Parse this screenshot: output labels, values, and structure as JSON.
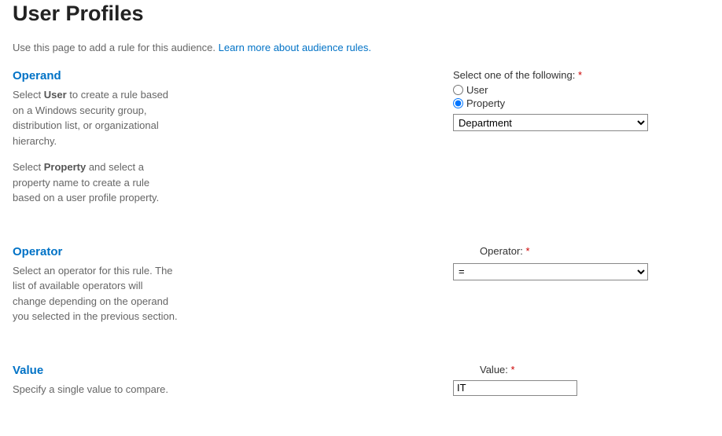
{
  "page_title": "User Profiles",
  "intro": {
    "text": "Use this page to add a rule for this audience. ",
    "link": "Learn more about audience rules."
  },
  "sections": {
    "operand": {
      "heading": "Operand",
      "desc1_pre": "Select ",
      "desc1_bold": "User",
      "desc1_post": " to create a rule based on a Windows security group, distribution list, or organizational hierarchy.",
      "desc2_pre": "Select ",
      "desc2_bold": "Property",
      "desc2_post": " and select a property name to create a rule based on a user profile property.",
      "label": "Select one of the following: ",
      "radio_user": "User",
      "radio_property": "Property",
      "select_value": "Department"
    },
    "operator": {
      "heading": "Operator",
      "desc": "Select an operator for this rule. The list of available operators will change depending on the operand you selected in the previous section.",
      "label": "Operator: ",
      "select_value": "="
    },
    "value": {
      "heading": "Value",
      "desc": "Specify a single value to compare.",
      "label": "Value: ",
      "input_value": "IT"
    }
  },
  "required_marker": "*"
}
